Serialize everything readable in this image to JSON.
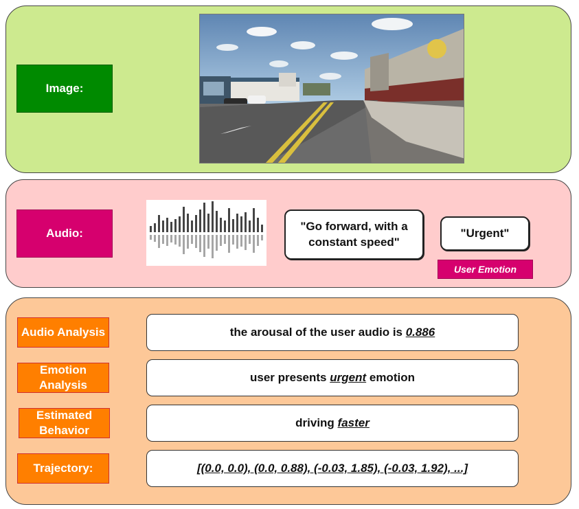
{
  "image_section": {
    "label": "Image:"
  },
  "audio_section": {
    "label": "Audio:",
    "command_text": "\"Go forward, with a constant speed\"",
    "emotion_text": "\"Urgent\"",
    "emotion_tag": "User Emotion"
  },
  "analysis_section": {
    "rows": [
      {
        "label": "Audio Analysis",
        "prefix": "the arousal of the user audio is ",
        "emphasis": "0.886",
        "suffix": ""
      },
      {
        "label": "Emotion Analysis",
        "prefix": "user presents ",
        "emphasis": "urgent",
        "suffix": " emotion"
      },
      {
        "label": "Estimated Behavior",
        "prefix": "driving ",
        "emphasis": "faster",
        "suffix": ""
      },
      {
        "label": "Trajectory:",
        "prefix": "",
        "emphasis": "[(0.0, 0.0), (0.0, 0.88), (-0.03, 1.85), (-0.03, 1.92), ...]",
        "suffix": ""
      }
    ]
  },
  "colors": {
    "image_panel": "#cdea8f",
    "audio_panel": "#ffcccc",
    "analysis_panel": "#fdc898",
    "image_label": "#008a00",
    "audio_label": "#d6006e",
    "analysis_label": "#ff7f00"
  }
}
